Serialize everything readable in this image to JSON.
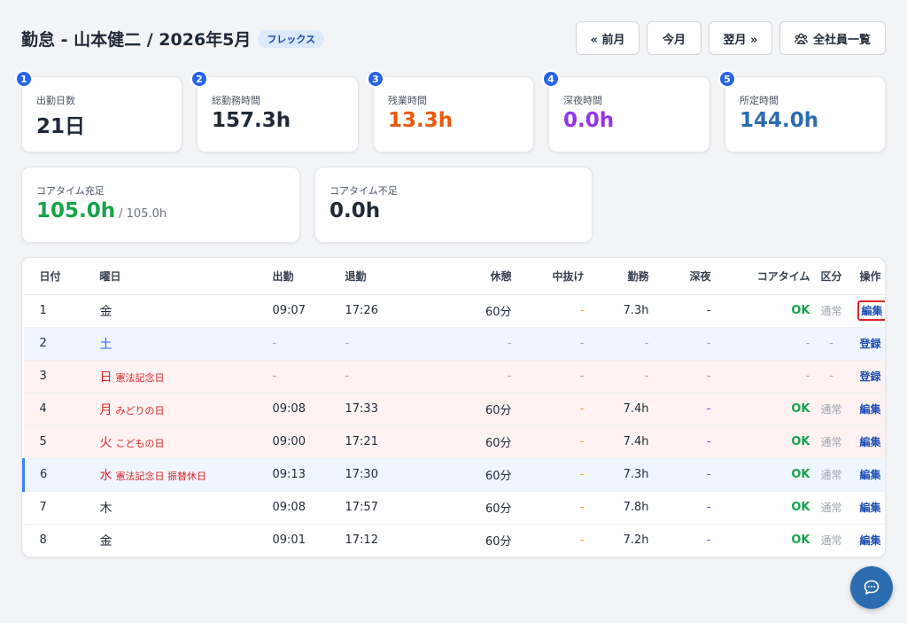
{
  "header": {
    "title": "勤怠 - 山本健二 / 2026年5月",
    "badge": "フレックス",
    "prev_label": "« 前月",
    "this_label": "今月",
    "next_label": "翌月 »",
    "all_label": "全社員一覧"
  },
  "summary": [
    {
      "num": "1",
      "label": "出勤日数",
      "value": "21日",
      "color": "#1f2937"
    },
    {
      "num": "2",
      "label": "総勤務時間",
      "value": "157.3h",
      "color": "#1f2937"
    },
    {
      "num": "3",
      "label": "残業時間",
      "value": "13.3h",
      "color": "#ea580c"
    },
    {
      "num": "4",
      "label": "深夜時間",
      "value": "0.0h",
      "color": "#9333ea"
    },
    {
      "num": "5",
      "label": "所定時間",
      "value": "144.0h",
      "color": "#2b6cb0"
    }
  ],
  "core": [
    {
      "label": "コアタイム充足",
      "value": "105.0h",
      "sub": "/ 105.0h",
      "color": "#16a34a"
    },
    {
      "label": "コアタイム不足",
      "value": "0.0h",
      "sub": "",
      "color": "#1f2937"
    }
  ],
  "table": {
    "headers": {
      "date": "日付",
      "dow": "曜日",
      "in": "出勤",
      "out": "退勤",
      "break": "休憩",
      "away": "中抜け",
      "work": "勤務",
      "night": "深夜",
      "core": "コアタイム",
      "kubun": "区分",
      "action": "操作"
    },
    "rows": [
      {
        "date": "1",
        "dow": "金",
        "holiday": "",
        "in": "09:07",
        "out": "17:26",
        "break": "60分",
        "away": "-",
        "work": "7.3h",
        "night": "-",
        "core": "OK",
        "kubun": "通常",
        "action": "編集"
      },
      {
        "date": "2",
        "dow": "土",
        "holiday": "",
        "in": "-",
        "out": "-",
        "break": "-",
        "away": "-",
        "work": "-",
        "night": "-",
        "core": "-",
        "kubun": "-",
        "action": "登録"
      },
      {
        "date": "3",
        "dow": "日",
        "holiday": "憲法記念日",
        "in": "-",
        "out": "-",
        "break": "-",
        "away": "-",
        "work": "-",
        "night": "-",
        "core": "-",
        "kubun": "-",
        "action": "登録"
      },
      {
        "date": "4",
        "dow": "月",
        "holiday": "みどりの日",
        "in": "09:08",
        "out": "17:33",
        "break": "60分",
        "away": "-",
        "work": "7.4h",
        "night": "-",
        "core": "OK",
        "kubun": "通常",
        "action": "編集"
      },
      {
        "date": "5",
        "dow": "火",
        "holiday": "こどもの日",
        "in": "09:00",
        "out": "17:21",
        "break": "60分",
        "away": "-",
        "work": "7.4h",
        "night": "-",
        "core": "OK",
        "kubun": "通常",
        "action": "編集"
      },
      {
        "date": "6",
        "dow": "水",
        "holiday": "憲法記念日 振替休日",
        "in": "09:13",
        "out": "17:30",
        "break": "60分",
        "away": "-",
        "work": "7.3h",
        "night": "-",
        "core": "OK",
        "kubun": "通常",
        "action": "編集"
      },
      {
        "date": "7",
        "dow": "木",
        "holiday": "",
        "in": "09:08",
        "out": "17:57",
        "break": "60分",
        "away": "-",
        "work": "7.8h",
        "night": "-",
        "core": "OK",
        "kubun": "通常",
        "action": "編集"
      },
      {
        "date": "8",
        "dow": "金",
        "holiday": "",
        "in": "09:01",
        "out": "17:12",
        "break": "60分",
        "away": "-",
        "work": "7.2h",
        "night": "-",
        "core": "OK",
        "kubun": "通常",
        "action": "編集"
      }
    ]
  },
  "fab": {
    "icon": "chat-icon"
  }
}
